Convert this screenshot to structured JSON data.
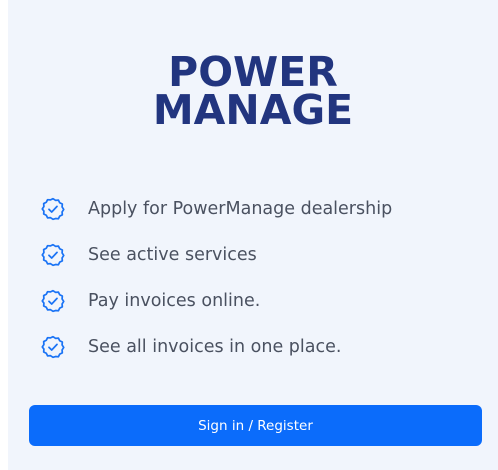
{
  "brand": {
    "line1": "POWER",
    "line2": "MANAGE",
    "color": "#22357f"
  },
  "features": [
    {
      "label": "Apply for PowerManage dealership",
      "icon": "check-badge-icon"
    },
    {
      "label": "See active services",
      "icon": "check-badge-icon"
    },
    {
      "label": "Pay invoices online.",
      "icon": "check-badge-icon"
    },
    {
      "label": "See all invoices in one place.",
      "icon": "check-badge-icon"
    }
  ],
  "cta": {
    "label": "Sign in / Register",
    "color": "#0b6cfb"
  },
  "colors": {
    "background": "#f1f5fc",
    "accent": "#1a73f5",
    "text": "#4a5160"
  }
}
